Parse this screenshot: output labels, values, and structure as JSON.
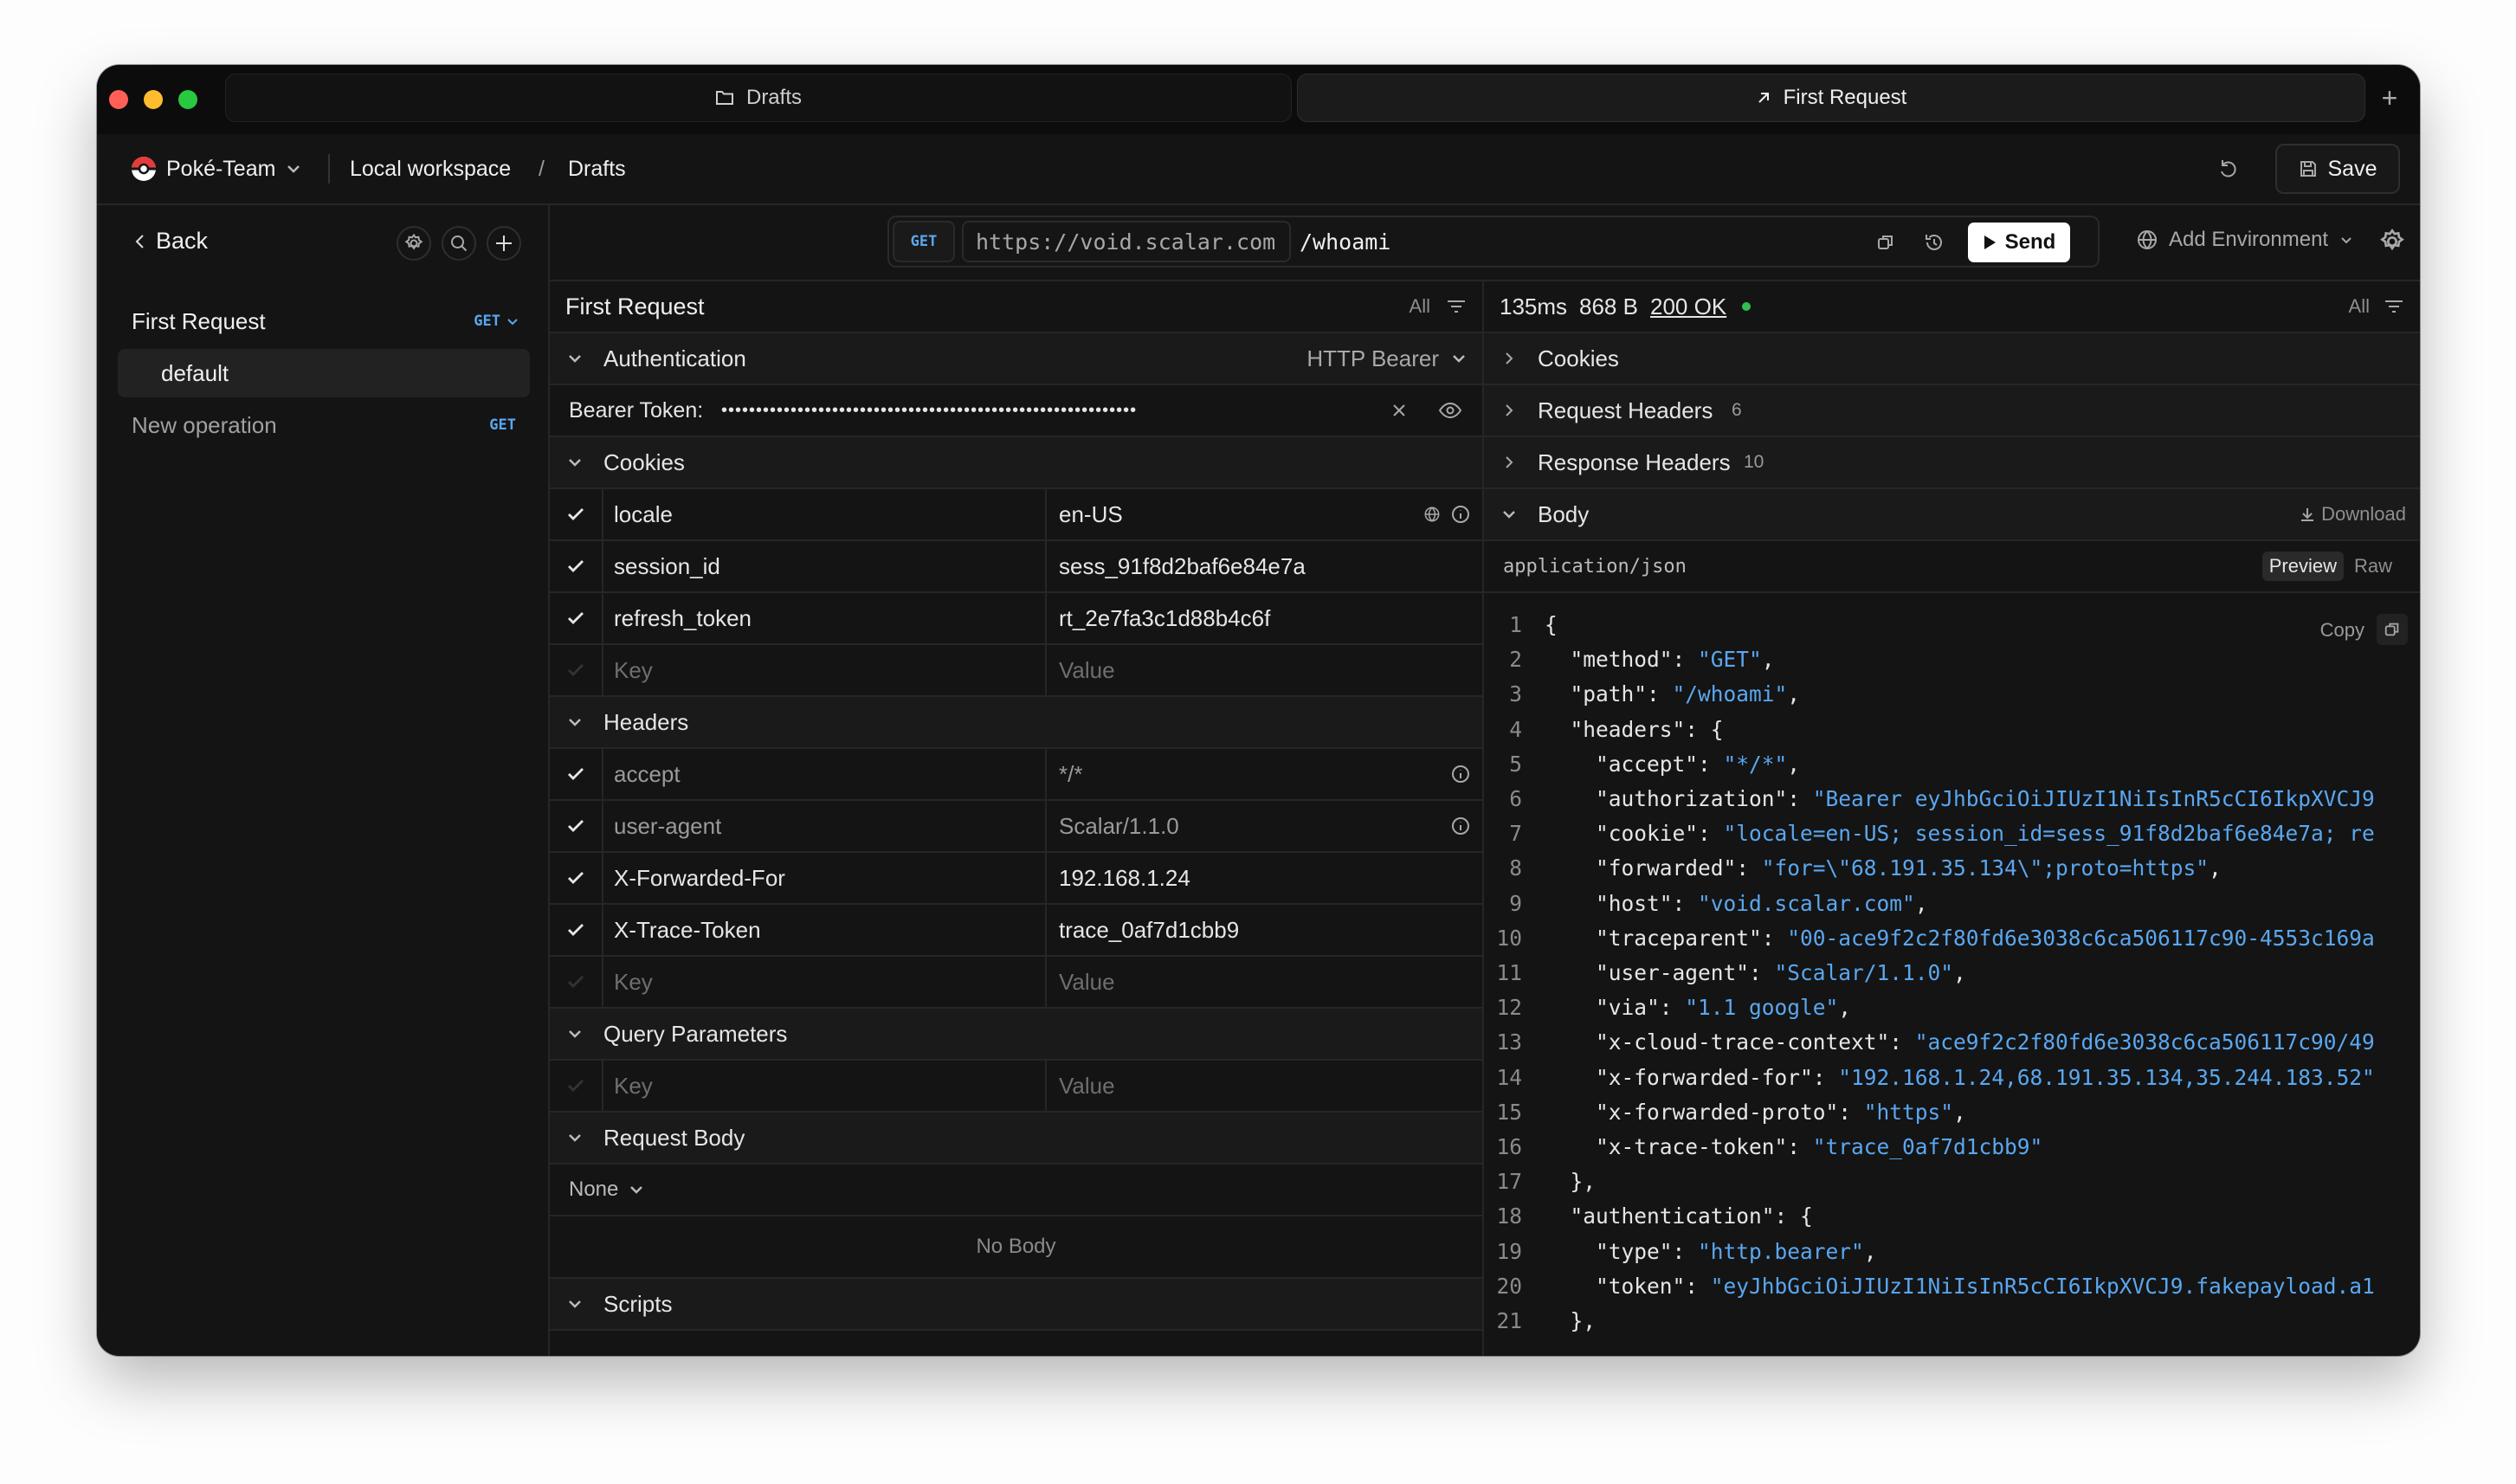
{
  "titlebar": {
    "tabs": [
      {
        "label": "Drafts",
        "icon": "folder-icon"
      },
      {
        "label": "First Request",
        "icon": "arrow-up-right-icon"
      }
    ],
    "new_tab_label": "+"
  },
  "toolbar": {
    "team": "Poké-Team",
    "workspace": "Local workspace",
    "separator": "/",
    "collection": "Drafts",
    "save_label": "Save"
  },
  "sidebar": {
    "back_label": "Back",
    "request": {
      "name": "First Request",
      "method": "GET"
    },
    "example": "default",
    "new_operation": {
      "label": "New operation",
      "method": "GET"
    }
  },
  "address": {
    "method": "GET",
    "server": "https://void.scalar.com",
    "path": "/whoami",
    "send_label": "Send",
    "environment": "Add Environment"
  },
  "request": {
    "title": "First Request",
    "filter": "All",
    "auth": {
      "title": "Authentication",
      "type": "HTTP Bearer",
      "token_label": "Bearer Token:",
      "token_masked": "••••••••••••••••••••••••••••••••••••••••••••••••••••••••••••"
    },
    "cookies": {
      "title": "Cookies",
      "rows": [
        {
          "key": "locale",
          "value": "en-US"
        },
        {
          "key": "session_id",
          "value": "sess_91f8d2baf6e84e7a"
        },
        {
          "key": "refresh_token",
          "value": "rt_2e7fa3c1d88b4c6f"
        }
      ]
    },
    "headers": {
      "title": "Headers",
      "rows": [
        {
          "key": "accept",
          "value": "*/*"
        },
        {
          "key": "user-agent",
          "value": "Scalar/1.1.0"
        },
        {
          "key": "X-Forwarded-For",
          "value": "192.168.1.24"
        },
        {
          "key": "X-Trace-Token",
          "value": "trace_0af7d1cbb9"
        }
      ]
    },
    "query": {
      "title": "Query Parameters"
    },
    "body": {
      "title": "Request Body",
      "type": "None",
      "empty": "No Body"
    },
    "scripts": {
      "title": "Scripts"
    },
    "key_placeholder": "Key",
    "value_placeholder": "Value"
  },
  "response": {
    "time": "135ms",
    "size": "868 B",
    "status": "200 OK",
    "filter": "All",
    "sections": {
      "cookies": "Cookies",
      "request_headers": "Request Headers",
      "request_headers_count": "6",
      "response_headers": "Response Headers",
      "response_headers_count": "10",
      "body": "Body"
    },
    "download": "Download",
    "content_type": "application/json",
    "preview": "Preview",
    "raw": "Raw",
    "copy": "Copy",
    "lines": [
      [
        "{"
      ],
      [
        "  \"method\": ",
        "\"GET\"",
        ","
      ],
      [
        "  \"path\": ",
        "\"/whoami\"",
        ","
      ],
      [
        "  \"headers\": {"
      ],
      [
        "    \"accept\": ",
        "\"*/*\"",
        ","
      ],
      [
        "    \"authorization\": ",
        "\"Bearer eyJhbGciOiJIUzI1NiIsInR5cCI6IkpXVCJ9",
        ""
      ],
      [
        "    \"cookie\": ",
        "\"locale=en-US; session_id=sess_91f8d2baf6e84e7a; re",
        ""
      ],
      [
        "    \"forwarded\": ",
        "\"for=\\\"68.191.35.134\\\";proto=https\"",
        ","
      ],
      [
        "    \"host\": ",
        "\"void.scalar.com\"",
        ","
      ],
      [
        "    \"traceparent\": ",
        "\"00-ace9f2c2f80fd6e3038c6ca506117c90-4553c169a",
        ""
      ],
      [
        "    \"user-agent\": ",
        "\"Scalar/1.1.0\"",
        ","
      ],
      [
        "    \"via\": ",
        "\"1.1 google\"",
        ","
      ],
      [
        "    \"x-cloud-trace-context\": ",
        "\"ace9f2c2f80fd6e3038c6ca506117c90/49",
        ""
      ],
      [
        "    \"x-forwarded-for\": ",
        "\"192.168.1.24,68.191.35.134,35.244.183.52\"",
        ""
      ],
      [
        "    \"x-forwarded-proto\": ",
        "\"https\"",
        ","
      ],
      [
        "    \"x-trace-token\": ",
        "\"trace_0af7d1cbb9\"",
        ""
      ],
      [
        "  },"
      ],
      [
        "  \"authentication\": {"
      ],
      [
        "    \"type\": ",
        "\"http.bearer\"",
        ","
      ],
      [
        "    \"token\": ",
        "\"eyJhbGciOiJIUzI1NiIsInR5cCI6IkpXVCJ9.fakepayload.a1",
        ""
      ],
      [
        "  },"
      ]
    ]
  },
  "colors": {
    "accent_blue": "#5aa7f0",
    "status_green": "#2fbf4f",
    "close": "#ff5f57",
    "minimize": "#febc2e",
    "zoom": "#28c840"
  }
}
